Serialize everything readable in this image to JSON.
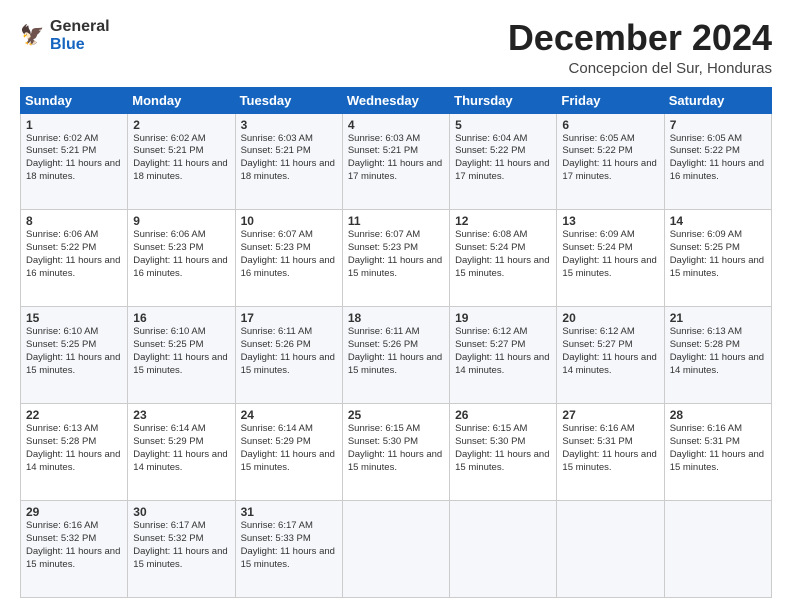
{
  "logo": {
    "general": "General",
    "blue": "Blue"
  },
  "title": "December 2024",
  "location": "Concepcion del Sur, Honduras",
  "days_of_week": [
    "Sunday",
    "Monday",
    "Tuesday",
    "Wednesday",
    "Thursday",
    "Friday",
    "Saturday"
  ],
  "weeks": [
    [
      {
        "day": "1",
        "sunrise": "6:02 AM",
        "sunset": "5:21 PM",
        "daylight": "11 hours and 18 minutes."
      },
      {
        "day": "2",
        "sunrise": "6:02 AM",
        "sunset": "5:21 PM",
        "daylight": "11 hours and 18 minutes."
      },
      {
        "day": "3",
        "sunrise": "6:03 AM",
        "sunset": "5:21 PM",
        "daylight": "11 hours and 18 minutes."
      },
      {
        "day": "4",
        "sunrise": "6:03 AM",
        "sunset": "5:21 PM",
        "daylight": "11 hours and 17 minutes."
      },
      {
        "day": "5",
        "sunrise": "6:04 AM",
        "sunset": "5:22 PM",
        "daylight": "11 hours and 17 minutes."
      },
      {
        "day": "6",
        "sunrise": "6:05 AM",
        "sunset": "5:22 PM",
        "daylight": "11 hours and 17 minutes."
      },
      {
        "day": "7",
        "sunrise": "6:05 AM",
        "sunset": "5:22 PM",
        "daylight": "11 hours and 16 minutes."
      }
    ],
    [
      {
        "day": "8",
        "sunrise": "6:06 AM",
        "sunset": "5:22 PM",
        "daylight": "11 hours and 16 minutes."
      },
      {
        "day": "9",
        "sunrise": "6:06 AM",
        "sunset": "5:23 PM",
        "daylight": "11 hours and 16 minutes."
      },
      {
        "day": "10",
        "sunrise": "6:07 AM",
        "sunset": "5:23 PM",
        "daylight": "11 hours and 16 minutes."
      },
      {
        "day": "11",
        "sunrise": "6:07 AM",
        "sunset": "5:23 PM",
        "daylight": "11 hours and 15 minutes."
      },
      {
        "day": "12",
        "sunrise": "6:08 AM",
        "sunset": "5:24 PM",
        "daylight": "11 hours and 15 minutes."
      },
      {
        "day": "13",
        "sunrise": "6:09 AM",
        "sunset": "5:24 PM",
        "daylight": "11 hours and 15 minutes."
      },
      {
        "day": "14",
        "sunrise": "6:09 AM",
        "sunset": "5:25 PM",
        "daylight": "11 hours and 15 minutes."
      }
    ],
    [
      {
        "day": "15",
        "sunrise": "6:10 AM",
        "sunset": "5:25 PM",
        "daylight": "11 hours and 15 minutes."
      },
      {
        "day": "16",
        "sunrise": "6:10 AM",
        "sunset": "5:25 PM",
        "daylight": "11 hours and 15 minutes."
      },
      {
        "day": "17",
        "sunrise": "6:11 AM",
        "sunset": "5:26 PM",
        "daylight": "11 hours and 15 minutes."
      },
      {
        "day": "18",
        "sunrise": "6:11 AM",
        "sunset": "5:26 PM",
        "daylight": "11 hours and 15 minutes."
      },
      {
        "day": "19",
        "sunrise": "6:12 AM",
        "sunset": "5:27 PM",
        "daylight": "11 hours and 14 minutes."
      },
      {
        "day": "20",
        "sunrise": "6:12 AM",
        "sunset": "5:27 PM",
        "daylight": "11 hours and 14 minutes."
      },
      {
        "day": "21",
        "sunrise": "6:13 AM",
        "sunset": "5:28 PM",
        "daylight": "11 hours and 14 minutes."
      }
    ],
    [
      {
        "day": "22",
        "sunrise": "6:13 AM",
        "sunset": "5:28 PM",
        "daylight": "11 hours and 14 minutes."
      },
      {
        "day": "23",
        "sunrise": "6:14 AM",
        "sunset": "5:29 PM",
        "daylight": "11 hours and 14 minutes."
      },
      {
        "day": "24",
        "sunrise": "6:14 AM",
        "sunset": "5:29 PM",
        "daylight": "11 hours and 15 minutes."
      },
      {
        "day": "25",
        "sunrise": "6:15 AM",
        "sunset": "5:30 PM",
        "daylight": "11 hours and 15 minutes."
      },
      {
        "day": "26",
        "sunrise": "6:15 AM",
        "sunset": "5:30 PM",
        "daylight": "11 hours and 15 minutes."
      },
      {
        "day": "27",
        "sunrise": "6:16 AM",
        "sunset": "5:31 PM",
        "daylight": "11 hours and 15 minutes."
      },
      {
        "day": "28",
        "sunrise": "6:16 AM",
        "sunset": "5:31 PM",
        "daylight": "11 hours and 15 minutes."
      }
    ],
    [
      {
        "day": "29",
        "sunrise": "6:16 AM",
        "sunset": "5:32 PM",
        "daylight": "11 hours and 15 minutes."
      },
      {
        "day": "30",
        "sunrise": "6:17 AM",
        "sunset": "5:32 PM",
        "daylight": "11 hours and 15 minutes."
      },
      {
        "day": "31",
        "sunrise": "6:17 AM",
        "sunset": "5:33 PM",
        "daylight": "11 hours and 15 minutes."
      },
      null,
      null,
      null,
      null
    ]
  ]
}
